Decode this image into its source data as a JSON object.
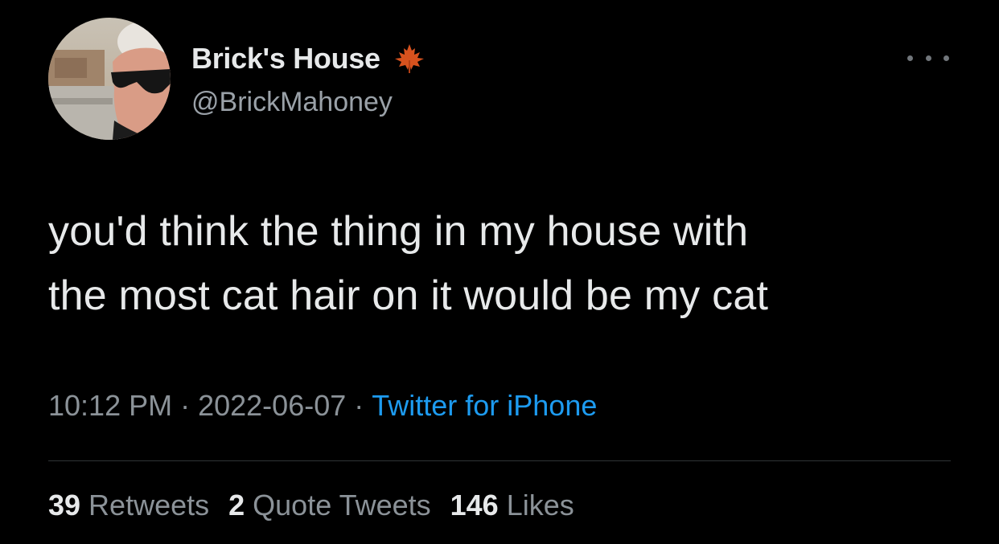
{
  "tweet": {
    "author": {
      "display_name": "Brick's House",
      "badge_icon": "maple-leaf-icon",
      "handle": "@BrickMahoney"
    },
    "more_icon": "more-options-icon",
    "text_lines": [
      "you'd think the thing in my house with",
      "the most cat hair on it would be my cat"
    ],
    "meta": {
      "time": "10:12 PM",
      "separator": "·",
      "date": "2022-06-07",
      "source": "Twitter for iPhone"
    },
    "stats": [
      {
        "count": "39",
        "label": "Retweets"
      },
      {
        "count": "2",
        "label": "Quote Tweets"
      },
      {
        "count": "146",
        "label": "Likes"
      }
    ]
  },
  "colors": {
    "background": "#000000",
    "primary_text": "#e7e9ea",
    "secondary_text": "#8b9298",
    "link": "#1d9bf0",
    "maple_leaf": "#d8521e",
    "divider": "#2f3336"
  }
}
